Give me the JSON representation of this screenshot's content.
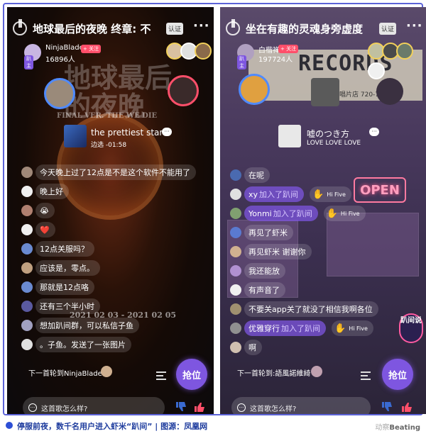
{
  "left_room": {
    "title": "地球最后的夜晚 终章: 不",
    "verify_badge": "认证",
    "more": "···",
    "host_name": "NinjaBlade",
    "host_count": "16896人",
    "host_tag": "趴主",
    "follow": "+ 关注",
    "bg_title": "地球最后的夜晚",
    "bg_sub": "FINAL VER. THE WE DIE",
    "bg_dates": "2021 02 03 - 2021 02 05",
    "song_title": "the prettiest star",
    "song_sub": "边选 -01:58",
    "messages": [
      {
        "text": "今天晚上过了12点是不是这个软件不能用了",
        "color": "#a08878"
      },
      {
        "text": "晚上好",
        "color": "#f0f0f0"
      },
      {
        "text": "😭",
        "color": "#b08070"
      },
      {
        "text": "❤️",
        "color": "#f0f0f0"
      },
      {
        "text": "12点关服吗？",
        "color": "#6a8ad0"
      },
      {
        "text": "应该是，零点。",
        "color": "#c0a080"
      },
      {
        "text": "那就是12点咯",
        "color": "#6a8ad0"
      },
      {
        "text": "还有三个半小时",
        "color": "#5a5aa0"
      },
      {
        "text": "想加趴间群，可以私信子鱼",
        "color": "#a0a0c0"
      },
      {
        "text": "。子鱼。发送了一张图片",
        "color": "#e0e0e0"
      }
    ],
    "next_up": "下一首轮到NinjaBlade",
    "grab": "抢位",
    "input_placeholder": "这首歌怎么样?"
  },
  "right_room": {
    "title": "坐在有趣的灵魂身旁虚度",
    "verify_badge": "认证",
    "more": "···",
    "host_name": "白楷禅",
    "host_count": "197724人",
    "host_tag": "趴主",
    "follow": "+ 关注",
    "bg_records": "RECORDS",
    "bg_shop": "虾米唱片店 720-7",
    "bg_open": "OPEN",
    "song_title": "嘘のつき方",
    "song_sub": "LOVE LOVE LOVE",
    "messages": [
      {
        "type": "text",
        "text": "在呢",
        "color": "#4a6ab0"
      },
      {
        "type": "join",
        "name": "xy",
        "action": "加入了趴间",
        "color": "#e0e0e0",
        "hifive": "Hi Five"
      },
      {
        "type": "join",
        "name": "Yonmi",
        "action": "加入了趴间",
        "color": "#80a070",
        "hifive": "Hi Five"
      },
      {
        "type": "text",
        "text": "再见了虾米",
        "color": "#5a7ad0"
      },
      {
        "type": "text",
        "text": "再见虾米 谢谢你",
        "color": "#d0b090"
      },
      {
        "type": "text",
        "text": "我还能放",
        "color": "#b090d0"
      },
      {
        "type": "text",
        "text": "有声音了",
        "color": "#f0f0f0"
      },
      {
        "type": "text",
        "text": "不要关app关了就没了相信我啊各位",
        "color": "#a09070"
      },
      {
        "type": "join",
        "name": "优雅穿行",
        "action": "加入了趴间",
        "color": "#909090",
        "hifive": "Hi Five"
      },
      {
        "type": "text",
        "text": "啊",
        "color": "#d0c0b0"
      }
    ],
    "next_up": "下一首轮到:語風諾維綺",
    "grab": "抢位",
    "input_placeholder": "这首歌怎么样?",
    "pa_badge": "趴间说"
  },
  "caption": {
    "text": "停服前夜，数千名用户进入虾米“趴间” | 图源：凤凰网",
    "brand_light": "动察",
    "brand_dark": "Beating"
  },
  "colors": {
    "accent": "#7e56e0",
    "follow": "#ff4f6a",
    "frame": "#5c63d8",
    "caption": "#1e3c9e"
  }
}
